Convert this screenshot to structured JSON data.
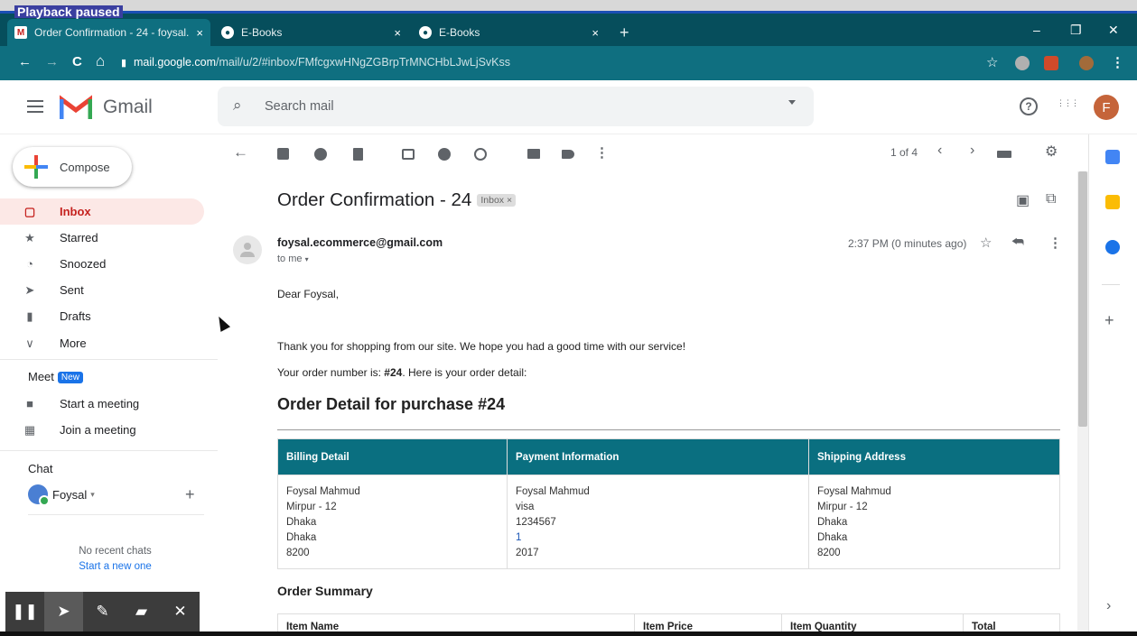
{
  "overlay": {
    "playback": "Playback paused"
  },
  "browser": {
    "tabs": [
      {
        "title": "Order Confirmation - 24 - foysal.",
        "close": "×"
      },
      {
        "title": "E-Books",
        "close": "×"
      },
      {
        "title": "E-Books",
        "close": "×"
      }
    ],
    "new_tab": "+",
    "window": {
      "minimize": "–",
      "restore": "❐",
      "close": "✕"
    },
    "nav": {
      "back": "←",
      "forward": "→",
      "reload": "C",
      "home": "⌂"
    },
    "url_host": "mail.google.com",
    "url_path": "/mail/u/2/#inbox/FMfcgxwHNgZGBrpTrMNCHbLJwLjSvKss",
    "star": "☆",
    "menu": "⋮"
  },
  "gmail": {
    "logo": "Gmail",
    "search_placeholder": "Search mail",
    "help": "?",
    "apps": "⋮⋮⋮",
    "avatar_letter": "F"
  },
  "sidebar": {
    "compose": "Compose",
    "items": [
      {
        "label": "Inbox",
        "icon": "▢"
      },
      {
        "label": "Starred",
        "icon": "★"
      },
      {
        "label": "Snoozed",
        "icon": "◔"
      },
      {
        "label": "Sent",
        "icon": "➤"
      },
      {
        "label": "Drafts",
        "icon": "▮"
      },
      {
        "label": "More",
        "icon": "∨"
      }
    ],
    "meet_title": "Meet",
    "meet_badge": "New",
    "meet_items": [
      {
        "label": "Start a meeting",
        "icon": "■"
      },
      {
        "label": "Join a meeting",
        "icon": "▦"
      }
    ],
    "chat_title": "Chat",
    "chat_user": "Foysal",
    "chat_user_caret": "▾",
    "chat_add": "+",
    "no_recent": "No recent chats",
    "start_new": "Start a new one"
  },
  "recorder": {
    "pause": "❚❚",
    "pointer": "➤",
    "pen": "✎",
    "marker": "▰",
    "close": "✕"
  },
  "toolbar": {
    "back": "←",
    "pager": "1 of 4",
    "prev": "‹",
    "next": "›",
    "settings": "⚙"
  },
  "message": {
    "subject": "Order Confirmation - 24",
    "label_chip": "Inbox ×",
    "sender": "foysal.ecommerce@gmail.com",
    "recipient": "to me",
    "recipient_caret": "▾",
    "time": "2:37 PM (0 minutes ago)",
    "star": "☆",
    "reply": "⮪",
    "more": "⋮",
    "print": "▣",
    "open_new": "⧉",
    "greeting": "Dear Foysal,",
    "thanks": "Thank you for shopping from our site. We hope you had a good time with our service!",
    "order_prefix": "Your order number is: ",
    "order_number": "#24",
    "order_suffix": ". Here is your order detail:",
    "order_heading": "Order Detail for purchase #24",
    "detail_headers": [
      "Billing Detail",
      "Payment Information",
      "Shipping Address"
    ],
    "billing": [
      "Foysal Mahmud",
      "Mirpur - 12",
      "Dhaka",
      "Dhaka",
      "8200"
    ],
    "payment": [
      "Foysal Mahmud",
      "visa",
      "1234567",
      "1",
      "2017"
    ],
    "shipping": [
      "Foysal Mahmud",
      "Mirpur - 12",
      "Dhaka",
      "Dhaka",
      "8200"
    ],
    "summary_heading": "Order Summary",
    "summary_headers": [
      "Item Name",
      "Item Price",
      "Item Quantity",
      "Total"
    ]
  },
  "rail": {
    "add": "+",
    "expand": "›"
  },
  "colors": {
    "header": "#0a6f80",
    "tabstrip": "#064e5c",
    "inbox_red": "#c5221f",
    "accent_blue": "#1a73e8"
  }
}
